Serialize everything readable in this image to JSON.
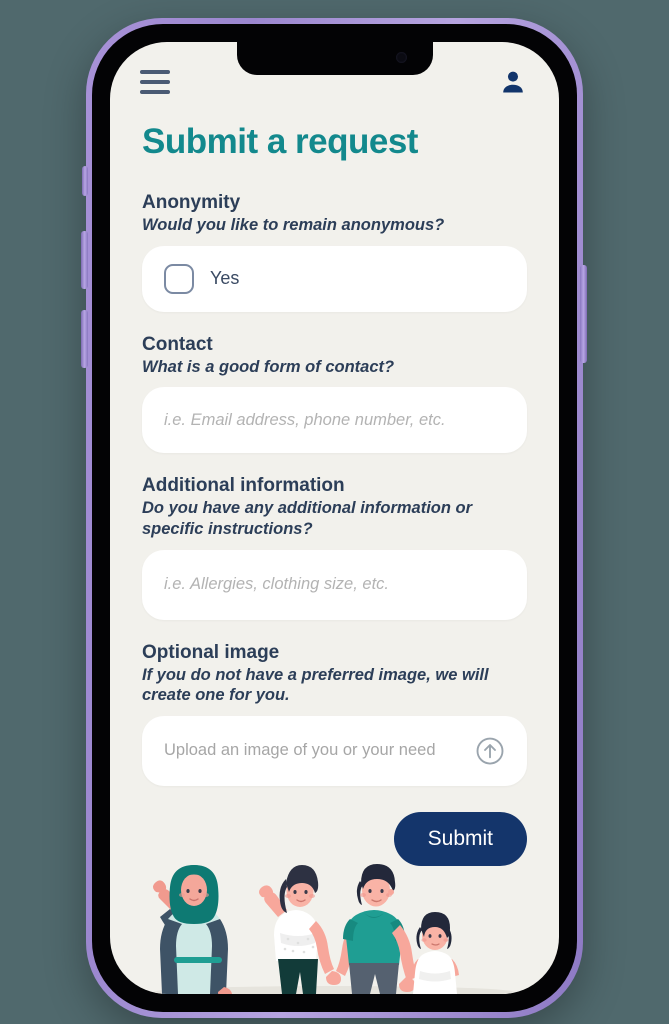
{
  "app": {
    "title": "Submit a request",
    "title_color": "#13898d",
    "screen_bg": "#f2f1ec",
    "page_bg": "#50696d",
    "phone_frame_color": "#a892d8"
  },
  "appbar": {
    "menu_icon": "hamburger-menu-icon",
    "account_icon": "person-icon"
  },
  "form": {
    "sections": [
      {
        "label": "Anonymity",
        "hint": "Would you like to remain anonymous?",
        "type": "checkbox",
        "option_label": "Yes",
        "checked": false
      },
      {
        "label": "Contact",
        "hint": "What is a good form of contact?",
        "type": "text",
        "value": "",
        "placeholder": "i.e. Email address, phone number, etc."
      },
      {
        "label": "Additional information",
        "hint": "Do you have any additional information or specific instructions?",
        "type": "text",
        "value": "",
        "placeholder": "i.e. Allergies, clothing size, etc."
      },
      {
        "label": "Optional image",
        "hint": "If you do not have a preferred image, we will create one for you.",
        "type": "upload",
        "value": "",
        "placeholder": "Upload an image of you or your need",
        "upload_icon": "upload-arrow-circle-icon"
      }
    ],
    "submit_label": "Submit",
    "submit_color": "#14356b"
  },
  "illustration": {
    "name": "family-group-illustration",
    "people": [
      "woman-in-hijab",
      "woman-waving",
      "man-teal-shirt",
      "child"
    ]
  }
}
